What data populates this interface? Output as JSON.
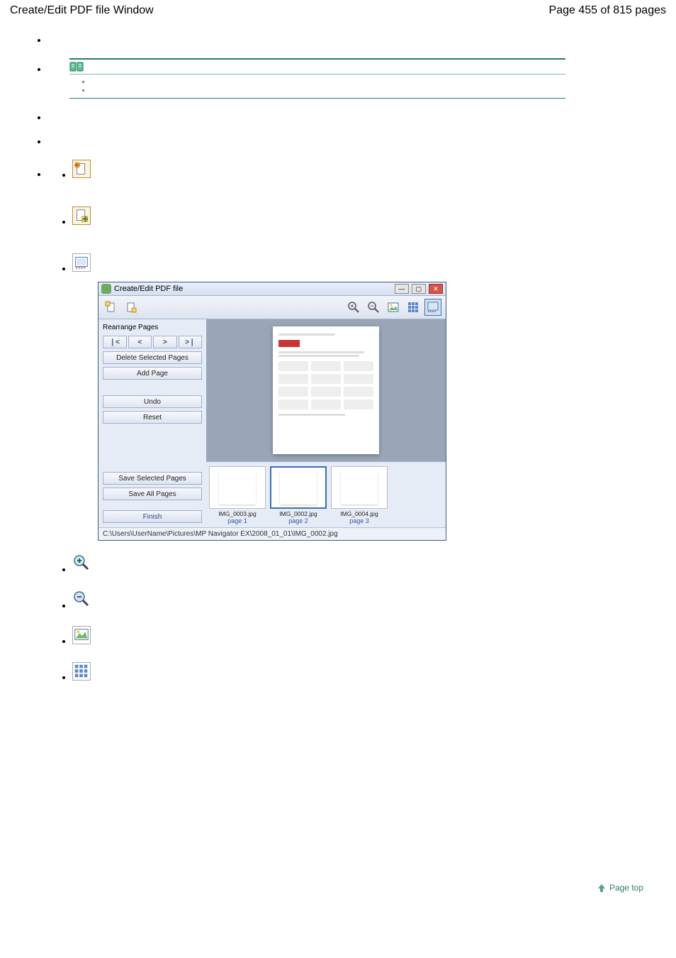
{
  "header": {
    "title": "Create/Edit PDF file Window",
    "page_label": "Page 455 of 815 pages"
  },
  "bullets": {
    "b1": "",
    "b2": "",
    "b3": "",
    "b4": "",
    "b5": ""
  },
  "note": {
    "title": "",
    "items": [
      "",
      ""
    ]
  },
  "sub_icons": {
    "a_title": "",
    "b_title": "",
    "c_title": ""
  },
  "app": {
    "title": "Create/Edit PDF file",
    "panel": {
      "rearrange": "Rearrange Pages",
      "nav": {
        "first": "❘<",
        "prev": "<",
        "next": ">",
        "last": ">❘"
      },
      "delete": "Delete Selected Pages",
      "add": "Add Page",
      "undo": "Undo",
      "reset": "Reset",
      "save_sel": "Save Selected Pages",
      "save_all": "Save All Pages",
      "finish": "Finish"
    },
    "thumbs": [
      {
        "file": "IMG_0003.jpg",
        "page": "page 1"
      },
      {
        "file": "IMG_0002.jpg",
        "page": "page 2"
      },
      {
        "file": "IMG_0004.jpg",
        "page": "page 3"
      }
    ],
    "status": "C:\\Users\\UserName\\Pictures\\MP Navigator EX\\2008_01_01\\IMG_0002.jpg"
  },
  "lower_icons": {
    "zoom_in": "",
    "zoom_out": "",
    "image_view": "",
    "thumb_view": ""
  },
  "top_link": "Page top"
}
